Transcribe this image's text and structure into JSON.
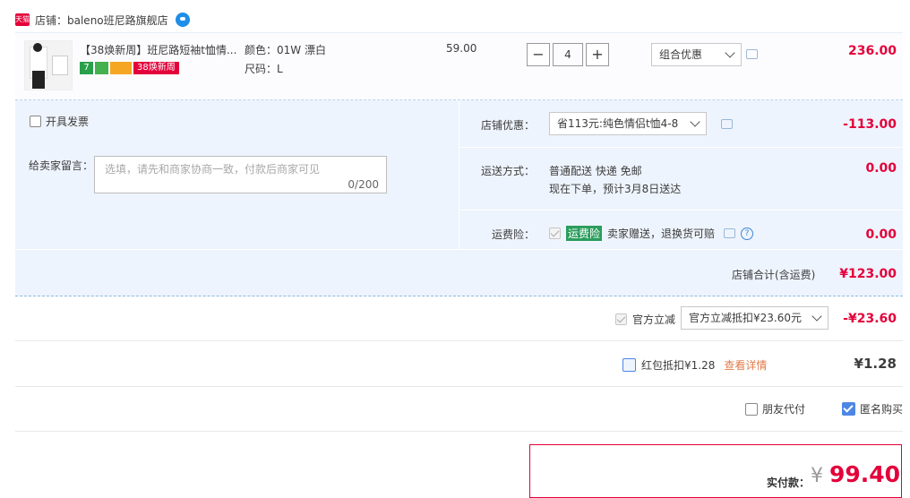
{
  "store": {
    "tmall_badge": "天猫",
    "label": "店铺：baleno班尼路旗舰店"
  },
  "item": {
    "title": "【38焕新周】班尼路短袖t恤情...",
    "badges": {
      "seven": "7",
      "promo": "38焕新周"
    },
    "color": "颜色：01W 漂白",
    "size": "尺码：L",
    "price": "59.00",
    "qty_minus": "−",
    "qty_value": "4",
    "qty_plus": "+",
    "combo_select": "组合优惠",
    "subtotal": "236.00"
  },
  "invoice": {
    "label": "开具发票"
  },
  "message": {
    "label": "给卖家留言：",
    "placeholder": "选填，请先和商家协商一致，付款后商家可见",
    "counter": "0/200"
  },
  "store_discount": {
    "label": "店铺优惠：",
    "select": "省113元:纯色情侣t恤4-8",
    "amount": "-113.00"
  },
  "shipping": {
    "label": "运送方式：",
    "line1": "普通配送 快递 免邮",
    "line2": "现在下单，预计3月8日送达",
    "amount": "0.00"
  },
  "insurance": {
    "label": "运费险：",
    "badge": "运费险",
    "text": "卖家赠送，退换货可赔",
    "help": "?",
    "amount": "0.00"
  },
  "store_total": {
    "label": "店铺合计(含运费)",
    "amount": "¥123.00"
  },
  "official": {
    "label": "官方立减",
    "select": "官方立减抵扣¥23.60元",
    "amount": "-¥23.60"
  },
  "redpacket": {
    "label": "红包抵扣¥1.28",
    "detail": "查看详情",
    "amount": "¥1.28"
  },
  "options": {
    "friend_pay": "朋友代付",
    "anonymous": "匿名购买"
  },
  "pay": {
    "label": "实付款：",
    "currency": "¥",
    "amount": "99.40"
  },
  "colors": {
    "accent": "#e4003a",
    "panel": "#eef4fd",
    "link": "#3d86d6"
  }
}
